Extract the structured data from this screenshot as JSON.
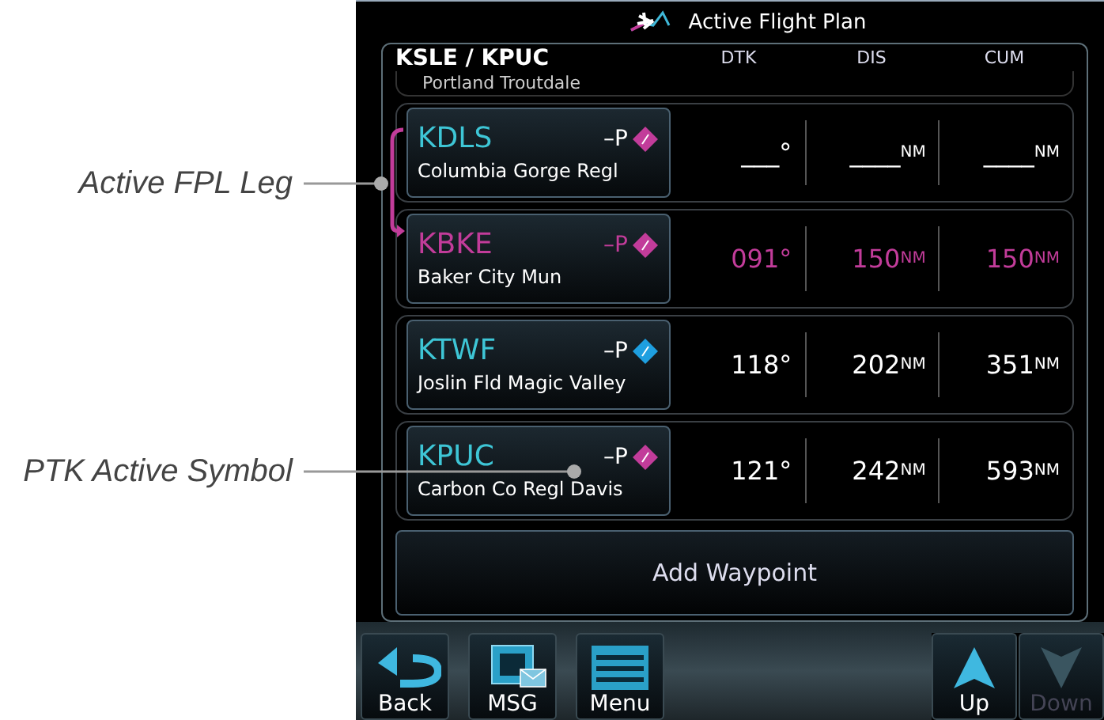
{
  "window": {
    "title": "Active Flight Plan"
  },
  "flight_plan": {
    "route": "KSLE / KPUC",
    "columns": [
      "DTK",
      "DIS",
      "CUM"
    ],
    "partial_row": {
      "name": "Portland Troutdale"
    },
    "legs": [
      {
        "ident": "KDLS",
        "suffix": "–P",
        "name": "Columbia Gorge Regl",
        "dtk": "___°",
        "dis": "____",
        "dis_unit": "NM",
        "cum": "____",
        "cum_unit": "NM",
        "active": false,
        "color": "#c23c9a"
      },
      {
        "ident": "KBKE",
        "suffix": "–P",
        "name": "Baker City Mun",
        "dtk": "091°",
        "dis": "150",
        "dis_unit": "NM",
        "cum": "150",
        "cum_unit": "NM",
        "active": true,
        "color": "#c23c9a"
      },
      {
        "ident": "KTWF",
        "suffix": "–P",
        "name": "Joslin Fld Magic Valley",
        "dtk": "118°",
        "dis": "202",
        "dis_unit": "NM",
        "cum": "351",
        "cum_unit": "NM",
        "active": false,
        "color": "#1e9fe0"
      },
      {
        "ident": "KPUC",
        "suffix": "–P",
        "name": "Carbon Co Regl Davis",
        "dtk": "121°",
        "dis": "242",
        "dis_unit": "NM",
        "cum": "593",
        "cum_unit": "NM",
        "active": false,
        "color": "#c23c9a"
      }
    ],
    "add_button": "Add Waypoint"
  },
  "toolbar": {
    "left": [
      {
        "label": "Back",
        "kind": "back"
      },
      {
        "label": "MSG",
        "kind": "msg"
      },
      {
        "label": "Menu",
        "kind": "menu"
      }
    ],
    "right": [
      {
        "label": "Up",
        "kind": "up",
        "disabled": false
      },
      {
        "label": "Down",
        "kind": "down",
        "disabled": true
      }
    ]
  },
  "callouts": [
    {
      "text": "Active FPL Leg",
      "kind": "leg"
    },
    {
      "text": "PTK Active Symbol",
      "kind": "symbol"
    }
  ]
}
